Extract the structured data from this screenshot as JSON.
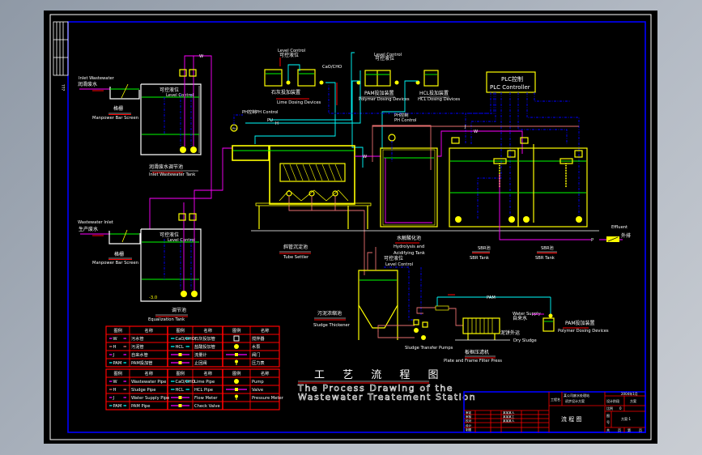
{
  "colors": {
    "background": "#000000",
    "equipment": "#ffff00",
    "water_level": "#00ff00",
    "wastewater_pipe": "#ff00ff",
    "dosing_pipe": "#00ffff",
    "control_line": "#0000ff",
    "sludge_pipe": "#e87070",
    "frame": "#0000ff",
    "table_lines": "#ff0000"
  },
  "side_label": "???",
  "inlet_tank": {
    "inlet_en": "Inlet Wastewater",
    "inlet_cn": "润滑废水",
    "screen_cn": "格栅",
    "screen_en": "Manpower Bar Screen",
    "level_cn": "可控液位",
    "level_en": "Level Control",
    "name_cn": "润滑废水调节池",
    "name_en": "Inlet Wastewater Tank",
    "pipe_tag": "W"
  },
  "equalization": {
    "inlet_en": "Wastewater Inlet",
    "inlet_cn": "生产废水",
    "screen_cn": "格栅",
    "screen_en": "Manpower Bar Screen",
    "level_cn": "可控液位",
    "level_en": "Level Control",
    "name_cn": "调节池",
    "name_en": "Equalization Tank",
    "elev": "-3.0"
  },
  "lime": {
    "level_en": "Level Control",
    "level_cn": "可控液位",
    "name_cn": "石灰投加装置",
    "name_en": "Lime Dosing Devices",
    "pipe_tag": "CaO/CHO"
  },
  "pam_top": {
    "level_en": "Level Control",
    "level_cn": "可控液位",
    "name_cn": "PAM投加装置",
    "name_en": "Polymer Dosing Devices"
  },
  "hcl": {
    "name_cn": "HCL投加装置",
    "name_en": "HCL Dosing Devices"
  },
  "plc": {
    "line1": "PLC控制",
    "line2": "PLC Controller"
  },
  "ph_control_1": {
    "cn": "PH控制",
    "en": "PH Control"
  },
  "ph_control_2": {
    "cn": "PH控制",
    "en": "PH Control"
  },
  "pipe_tags": {
    "pu": "PU",
    "h": "H",
    "w": "W",
    "w2": "W",
    "p": "P",
    "j": "J",
    "j2": "J",
    "ph": "PH"
  },
  "tube_settler": {
    "name_cn": "斜管沉淀池",
    "name_en": "Tube Settler"
  },
  "hydrolysis": {
    "name_cn": "水解酸化池",
    "name_en_1": "Hydrolysis and",
    "name_en_2": "Acidifying Tank"
  },
  "sbr1": {
    "name_cn": "SBR池",
    "name_en": "SBR Tank"
  },
  "sbr2": {
    "name_cn": "SBR池",
    "name_en": "SBR Tank"
  },
  "effluent": {
    "en": "Effluent",
    "cn": "外排"
  },
  "thickener": {
    "level_cn": "可控液位",
    "level_en": "Level Control",
    "name_cn": "污泥浓缩池",
    "name_en": "Sludge Thickener",
    "pump_label": "Sludge Transfer Pumps"
  },
  "filter_press": {
    "name_cn": "板框压滤机",
    "name_en": "Plate and Frame Filter Press",
    "dry_cn": "泥饼外运",
    "dry_en": "Dry Sludge",
    "pam_tag": "PAM",
    "water_en": "Water Supply",
    "water_cn": "自来水",
    "pam_cn": "PAM投加装置",
    "pam_en": "Polymer Dosing Devices"
  },
  "title": {
    "cn": "工 艺 流 程 图",
    "en_1": "The Process Drawing of the",
    "en_2": "Wastewater Treatement Station"
  },
  "legend_cn": {
    "headers": [
      "图例",
      "名称",
      "图例",
      "名称",
      "图例",
      "名称"
    ],
    "rows": [
      [
        {
          "sym": "line",
          "color": "#ff00ff",
          "tag": "W"
        },
        "污水管",
        {
          "sym": "line",
          "color": "#00ffff",
          "tag": "CaO/CHO"
        },
        "石灰投加管",
        {
          "sym": "mixer"
        },
        "搅拌器"
      ],
      [
        {
          "sym": "line",
          "color": "#e87070",
          "tag": "H"
        },
        "污泥管",
        {
          "sym": "line",
          "color": "#00ffff",
          "tag": "HCL"
        },
        "盐酸投加管",
        {
          "sym": "pump"
        },
        "水泵"
      ],
      [
        {
          "sym": "line",
          "color": "#ff00ff",
          "tag": "J"
        },
        "自来水管",
        {
          "sym": "meter",
          "color": "#ff00ff"
        },
        "流量计",
        {
          "sym": "meter",
          "color": "#ff00ff"
        },
        "阀门"
      ],
      [
        {
          "sym": "line",
          "color": "#00ffff",
          "tag": "PAM"
        },
        "PAM投加管",
        {
          "sym": "check",
          "color": "#ff00ff"
        },
        "止回阀",
        {
          "sym": "gauge"
        },
        "压力表"
      ]
    ]
  },
  "legend_en": {
    "headers": [
      "图例",
      "名称",
      "图例",
      "名称",
      "图例",
      "名称"
    ],
    "rows": [
      [
        {
          "sym": "line",
          "color": "#ff00ff",
          "tag": "W"
        },
        "Wastewater Pipe",
        {
          "sym": "line",
          "color": "#00ffff",
          "tag": "CaO/CHO"
        },
        "Lime Pipe",
        {
          "sym": "pump"
        },
        "Pump"
      ],
      [
        {
          "sym": "line",
          "color": "#e87070",
          "tag": "H"
        },
        "Sludge Pipe",
        {
          "sym": "line",
          "color": "#00ffff",
          "tag": "HCL"
        },
        "HCL Pipe",
        {
          "sym": "meter",
          "color": "#ff00ff"
        },
        "Valve"
      ],
      [
        {
          "sym": "line",
          "color": "#ff00ff",
          "tag": "J"
        },
        "Water Supply Pipe",
        {
          "sym": "meter",
          "color": "#ff00ff"
        },
        "Flow Meter",
        {
          "sym": "gauge"
        },
        "Pressure Meter"
      ],
      [
        {
          "sym": "line",
          "color": "#00ffff",
          "tag": "PAM"
        },
        "PAM Pipe",
        {
          "sym": "check",
          "color": "#ff00ff"
        },
        "Check Valve",
        {
          "sym": "none"
        },
        ""
      ]
    ]
  },
  "title_block": {
    "project_label": "工程名",
    "project_1": "某公司废水处理站",
    "project_2": "初步设计方案",
    "drawing_name": "流 程 图",
    "date": "2004年1月",
    "stage_label": "设计阶段",
    "stage": "方案",
    "scale_label": "比例",
    "scale": "0",
    "sheet_label_1": "图",
    "sheet_label_2": "号",
    "sheet_no": "方案-1",
    "total_1": "共",
    "total_2": "页",
    "page_1": "第",
    "page_2": "页",
    "roles": [
      "审定",
      "审核",
      "校对",
      "设计",
      "制图"
    ],
    "signers": [
      "某某某人",
      "某某某工",
      "某某某人"
    ]
  }
}
